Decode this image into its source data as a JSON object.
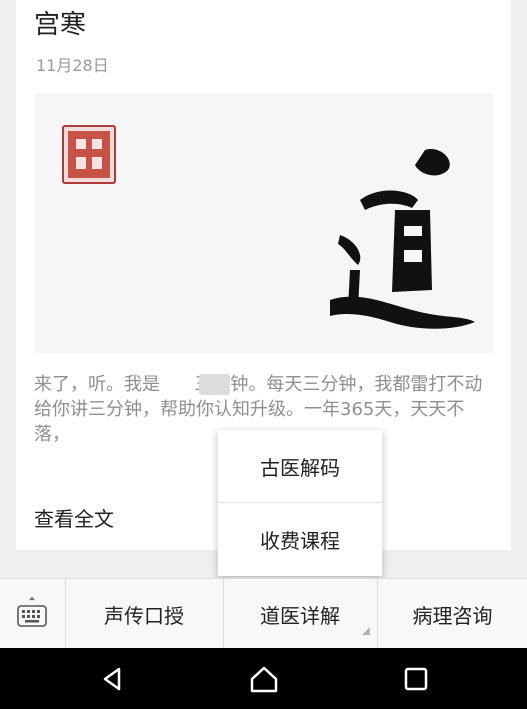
{
  "post": {
    "title": "宫寒",
    "date": "11月28日",
    "excerpt": "来了，听。我是      三分钟。每天三分钟，我都雷打不动给你讲三分钟，帮助你认知升级。一年365天，天天不落，",
    "read_more": "查看全文"
  },
  "cover": {
    "seal_icon": "seal-stamp-icon",
    "seal_color": "#b03a3a",
    "calligraphy_icon": "dao-calligraphy-icon"
  },
  "popup_menu": {
    "items": [
      {
        "label": "古医解码"
      },
      {
        "label": "收费课程"
      }
    ]
  },
  "menu_bar": {
    "keyboard_icon": "keyboard-icon",
    "tabs": [
      {
        "label": "声传口授"
      },
      {
        "label": "道医详解"
      },
      {
        "label": "病理咨询"
      }
    ]
  },
  "navbar": {
    "back_icon": "back-triangle-icon",
    "home_icon": "home-icon",
    "recents_icon": "recents-square-icon"
  }
}
